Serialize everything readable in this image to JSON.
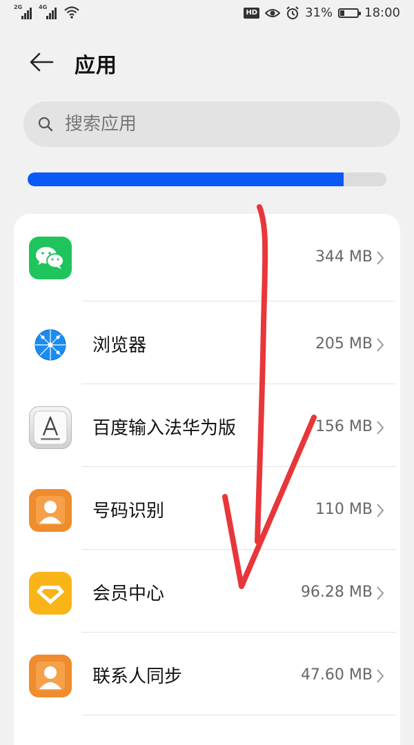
{
  "status_bar": {
    "net1": "2G",
    "net2": "4G",
    "hd_label": "HD",
    "battery_percent": "31%",
    "battery_level": 0.31,
    "time": "18:00"
  },
  "header": {
    "title": "应用"
  },
  "search": {
    "placeholder": "搜索应用"
  },
  "storage": {
    "used_fraction": 0.88
  },
  "colors": {
    "accent": "#0a59f7",
    "annotation": "#e8363a"
  },
  "apps": [
    {
      "name": "",
      "size": "344 MB",
      "icon": "wechat-icon"
    },
    {
      "name": "浏览器",
      "size": "205 MB",
      "icon": "browser-icon"
    },
    {
      "name": "百度输入法华为版",
      "size": "156 MB",
      "icon": "baidu-input-icon"
    },
    {
      "name": "号码识别",
      "size": "110 MB",
      "icon": "contact-person-icon"
    },
    {
      "name": "会员中心",
      "size": "96.28 MB",
      "icon": "member-center-icon"
    },
    {
      "name": "联系人同步",
      "size": "47.60 MB",
      "icon": "contact-person-icon"
    }
  ]
}
